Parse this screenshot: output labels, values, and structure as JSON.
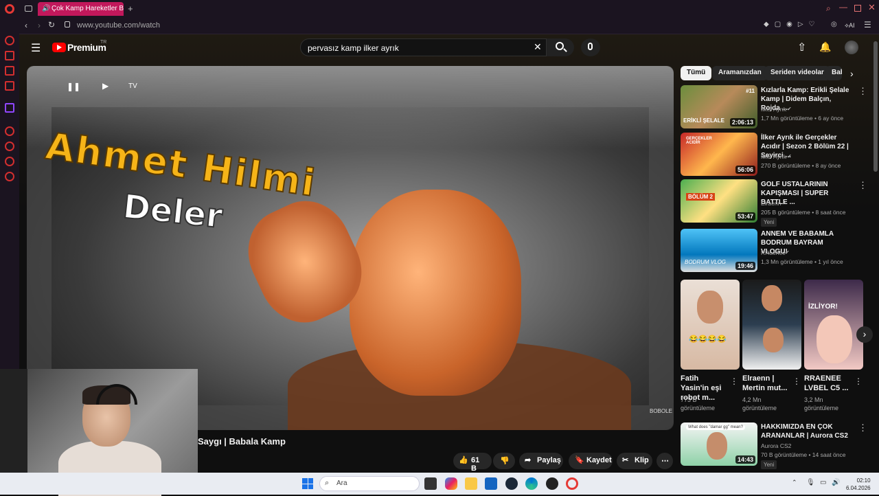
{
  "browser": {
    "tab_title": "Çok Kamp Hareketler B",
    "url": "www.youtube.com/watch",
    "ai_label": "AI"
  },
  "youtube": {
    "logo": "Premium",
    "logo_sup": "TR",
    "search_value": "pervasız kamp ilker ayrık"
  },
  "video": {
    "overlay_title_line1": "Ahmet Hilmi",
    "overlay_title_line2": "Deler",
    "tv_label": "TV",
    "watermark": "BOBOLE",
    "title": "Saygı | Babala Kamp",
    "actions": {
      "likes": "61 B",
      "share": "Paylaş",
      "save": "Kaydet",
      "clip": "Klip"
    }
  },
  "sidebar": {
    "chips": [
      "Tümü",
      "Aramanızdan",
      "Seriden videolar",
      "Bab"
    ],
    "videos": [
      {
        "title": "Kızlarla Kamp: Erikli Şelale Kamp | Didem Balçın, Rojda ...",
        "channel": "İlker Ayrık",
        "meta": "1,7 Mn görüntüleme • 6 ay önce",
        "duration": "2:06:13",
        "thumb_text": "ERİKLİ ŞELALE",
        "badge": "#11"
      },
      {
        "title": "İlker Ayrık ile Gerçekler Acıdır | Sezon 2 Bölüm 22 | Seyirci ...",
        "channel": "İlker Ayrık",
        "meta": "270 B görüntüleme • 8 ay önce",
        "duration": "56:06",
        "thumb_text": "GERÇEKLER ACIDIR"
      },
      {
        "title": "GOLF USTALARININ KAPIŞMASI | SUPER BATTLE ...",
        "channel": "Elraenn",
        "meta": "205 B görüntüleme • 8 saat önce",
        "duration": "53:47",
        "badge_new": "Yeni",
        "thumb_text": "BÖLÜM 2"
      },
      {
        "title": "ANNEM VE BABAMLA BODRUM BAYRAM VLOGU!",
        "channel": "RRaenee",
        "meta": "1,3 Mn görüntüleme • 1 yıl önce",
        "duration": "19:46",
        "thumb_text": "BODRUM VLOG"
      }
    ],
    "shorts": [
      {
        "title": "Fatih Yasin'in eşi robot m...",
        "views": "773 B görüntüleme"
      },
      {
        "title": "Elraenn | Mertin mut...",
        "views": "4,2 Mn görüntüleme"
      },
      {
        "title": "RRAENEE LVBEL C5 ...",
        "views": "3,2 Mn görüntüleme",
        "badge": "İZLİYOR!"
      }
    ],
    "last_video": {
      "title": "HAKKIMIZDA EN ÇOK ARANANLAR | Aurora CS2",
      "channel": "Aurora CS2",
      "meta": "70 B görüntüleme • 14 saat önce",
      "duration": "14:43",
      "badge_new": "Yeni",
      "thumb_text": "What does \"damar gg\" mean?"
    }
  },
  "taskbar": {
    "search_placeholder": "Ara",
    "time": "02:10",
    "date": "6.04.2026"
  }
}
